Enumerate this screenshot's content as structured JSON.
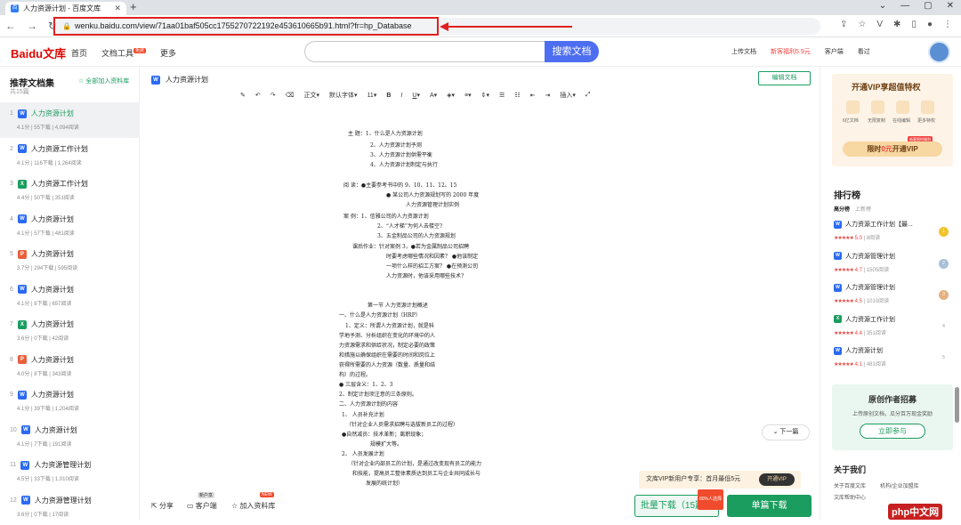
{
  "browser": {
    "tab_title": "人力资源计划 - 百度文库",
    "url": "wenku.baidu.com/view/71aa01baf505cc1755270722192e453610665b91.html?fr=hp_Database"
  },
  "site": {
    "logo_main": "Bai",
    "logo_accent": "du",
    "logo_suffix": "文库",
    "nav": [
      "首页",
      "文档工具",
      "更多"
    ],
    "nav_badge": "免费",
    "search_button": "搜索文档",
    "right_nav": [
      "上传文档",
      "新客福利5.9元",
      "客户端",
      "看过"
    ]
  },
  "sidebar": {
    "title": "推荐文档集",
    "count": "共15篇",
    "add_all": "全部加入资料库",
    "items": [
      {
        "num": "1",
        "icon": "W",
        "color": "#2b6af3",
        "label": "人力资源计划",
        "meta": "4.1分 | 55下载 | 4,094阅读"
      },
      {
        "num": "2",
        "icon": "W",
        "color": "#2b6af3",
        "label": "人力资源工作计划",
        "meta": "4.1分 | 116下载 | 1,264阅读"
      },
      {
        "num": "3",
        "icon": "X",
        "color": "#1b9d5f",
        "label": "人力资源工作计划",
        "meta": "4.4分 | 50下载 | 351阅读"
      },
      {
        "num": "4",
        "icon": "W",
        "color": "#2b6af3",
        "label": "人力资源计划",
        "meta": "4.1分 | 57下载 | 481阅读"
      },
      {
        "num": "5",
        "icon": "P",
        "color": "#e8603c",
        "label": "人力资源计划",
        "meta": "3.7分 | 294下载 | 595阅读"
      },
      {
        "num": "6",
        "icon": "W",
        "color": "#2b6af3",
        "label": "人力资源计划",
        "meta": "4.1分 | 8下载 | 657阅读"
      },
      {
        "num": "7",
        "icon": "X",
        "color": "#1b9d5f",
        "label": "人力资源计划",
        "meta": "3.6分 | 0下载 | 42阅读"
      },
      {
        "num": "8",
        "icon": "P",
        "color": "#e8603c",
        "label": "人力资源计划",
        "meta": "4.0分 | 8下载 | 343阅读"
      },
      {
        "num": "9",
        "icon": "W",
        "color": "#2b6af3",
        "label": "人力资源计划",
        "meta": "4.1分 | 39下载 | 1,204阅读"
      },
      {
        "num": "10",
        "icon": "W",
        "color": "#2b6af3",
        "label": "人力资源计划",
        "meta": "4.1分 | 7下载 | 191阅读"
      },
      {
        "num": "11",
        "icon": "W",
        "color": "#2b6af3",
        "label": "人力资源管理计划",
        "meta": "4.5分 | 33下载 | 1,010阅读"
      },
      {
        "num": "12",
        "icon": "W",
        "color": "#2b6af3",
        "label": "人力资源管理计划",
        "meta": "3.6分 | 0下载 | 17阅读"
      }
    ]
  },
  "doc": {
    "title": "人力资源计划",
    "edit_button": "编辑文档",
    "toolbar": [
      "正文",
      "默认字体",
      "11"
    ],
    "insert": "插入",
    "lines": [
      "主  题：1、什么是人力资源计划",
      "2、人力资源计划予测",
      "3、人力资源计划供需平衡",
      "4、人力资源计划制定与执行",
      "阅  读：●主要参考书中的 9、10、11、12、15",
      "● 某公司人力资源规划写的 2000 年度",
      "人力资源管理计划实例",
      "案  例：1、信雅公司的人力资源计划",
      "2、“人才梯”为何人去楼空?",
      "3、五金制品公司的人力资源规划",
      "课后作业：针对案例 3，●若为金属制品公司招聘",
      "时要考虑哪些情况和因素？  ●他该制定",
      "一项什么样的招工方案？  ●在预测公司",
      "人力资源时，他该采用哪些技术?",
      "第一节  人力资源计划概述",
      "一、什么是人力资源计划（HRP）",
      "1、定义：所谓人力资源计划，就是科",
      "学地予测、分析组织在变化的环境中的人",
      "力资源需求和供给状况，制定必要的政策",
      "和措施以确保组织在需要的时间和岗位上",
      "获得所需要的人力资源（数量、质量和结",
      "构）的过程。",
      "● 三层含义：1、2、3",
      "2、制定计划须注意的三条原则。",
      "二、人力资源计划的内容",
      "1、      人员补充计划",
      "（针对企业人员需求招聘与选拔新员工的过程）",
      "●自然减员：技术革新；离职现象；",
      "规模扩大等。",
      "2、      人员发展计划",
      "（针对企业内部员工的计划，是通过改变现有员工的能力",
      "和技能，提高员工整体素质达到员工与企业共同成长与",
      "发展的统计划）"
    ],
    "next_page": "下一篇",
    "vip_promo": "文库VIP新用户专享：首月最低5元",
    "vip_open": "开通VIP",
    "bottom": {
      "share": "分享",
      "client": "客户端",
      "client_tag": "新户享",
      "add_lib": "加入资料库",
      "add_tag": "NEW",
      "batch": "批量下载（15篇）",
      "batch_tag": "80%人选择",
      "single": "单篇下载"
    }
  },
  "right": {
    "vip_title": "开通VIP享超值特权",
    "vip_feats": [
      "6亿文档",
      "无限复制",
      "在线编辑",
      "更多特权"
    ],
    "vip_btn_a": "限时",
    "vip_btn_b": "0元",
    "vip_btn_c": "开通VIP",
    "vip_tag": "新客限时福利",
    "rank_title": "排行榜",
    "rank_tabs": [
      "高分榜",
      "上新榜"
    ],
    "rank": [
      {
        "icon": "W",
        "color": "#2b6af3",
        "label": "人力资源工作计划【最...",
        "score": "5.0",
        "reads": "8阅读",
        "medal": "#f3c22b"
      },
      {
        "icon": "W",
        "color": "#2b6af3",
        "label": "人力资源管理计划",
        "score": "4.7",
        "reads": "1505阅读",
        "medal": "#a9c0d8"
      },
      {
        "icon": "W",
        "color": "#2b6af3",
        "label": "人力资源管理计划",
        "score": "4.5",
        "reads": "1010阅读",
        "medal": "#e4b27e"
      },
      {
        "icon": "X",
        "color": "#1b9d5f",
        "label": "人力资源工作计划",
        "score": "4.4",
        "reads": "351阅读",
        "medal": ""
      },
      {
        "icon": "W",
        "color": "#2b6af3",
        "label": "人力资源计划",
        "score": "4.1",
        "reads": "481阅读",
        "medal": ""
      }
    ],
    "rank_nums": [
      "4",
      "5"
    ],
    "author_title": "原创作者招募",
    "author_desc": "上传原创文档，瓜分百万现金奖励",
    "author_btn": "立即参与",
    "about_title": "关于我们",
    "about_links": [
      "关于百度文库",
      "机构/企业加盟库",
      "文库帮助中心"
    ]
  },
  "watermark": "php中文网"
}
